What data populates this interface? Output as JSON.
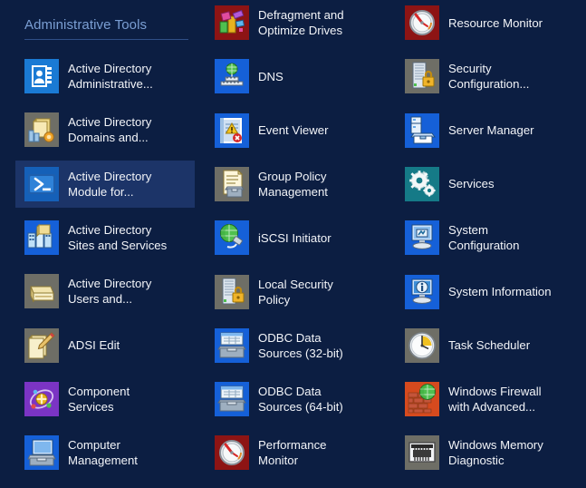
{
  "group": {
    "title": "Administrative Tools",
    "rule_color": "#2f4f86",
    "title_color": "#7b9fd4"
  },
  "theme": {
    "background": "#0c1e42",
    "selection": "#1c3468",
    "label_color": "#f2f4f8"
  },
  "columns": [
    {
      "index": 1,
      "tiles": [
        {
          "label": "Active Directory\nAdministrative...",
          "icon": "address-book-icon",
          "icon_bg": "#1a7ad4",
          "selected": false
        },
        {
          "label": "Active Directory\nDomains and...",
          "icon": "ad-domains-trusts-icon",
          "icon_bg": "#6e6e66",
          "selected": false
        },
        {
          "label": "Active Directory\nModule for...",
          "icon": "powershell-icon",
          "icon_bg": "#1560b8",
          "selected": true
        },
        {
          "label": "Active Directory\nSites and Services",
          "icon": "ad-sites-services-icon",
          "icon_bg": "#1560d8",
          "selected": false
        },
        {
          "label": "Active Directory\nUsers and...",
          "icon": "ad-users-computers-icon",
          "icon_bg": "#6e6e66",
          "selected": false
        },
        {
          "label": "ADSI Edit",
          "icon": "adsi-edit-icon",
          "icon_bg": "#6e6e66",
          "selected": false
        },
        {
          "label": "Component\nServices",
          "icon": "component-services-icon",
          "icon_bg": "#7b34c4",
          "selected": false
        },
        {
          "label": "Computer\nManagement",
          "icon": "computer-management-icon",
          "icon_bg": "#1560d8",
          "selected": false
        }
      ]
    },
    {
      "index": 2,
      "tiles": [
        {
          "label": "Defragment and\nOptimize Drives",
          "icon": "defragment-icon",
          "icon_bg": "#8d1414",
          "selected": false
        },
        {
          "label": "DNS",
          "icon": "dns-icon",
          "icon_bg": "#1560d8",
          "selected": false
        },
        {
          "label": "Event Viewer",
          "icon": "event-viewer-icon",
          "icon_bg": "#1560d8",
          "selected": false
        },
        {
          "label": "Group Policy\nManagement",
          "icon": "group-policy-icon",
          "icon_bg": "#6e6e66",
          "selected": false
        },
        {
          "label": "iSCSI Initiator",
          "icon": "iscsi-initiator-icon",
          "icon_bg": "#1560d8",
          "selected": false
        },
        {
          "label": "Local Security\nPolicy",
          "icon": "local-security-icon",
          "icon_bg": "#6e6e66",
          "selected": false
        },
        {
          "label": "ODBC Data\nSources (32-bit)",
          "icon": "odbc-32-icon",
          "icon_bg": "#1560d8",
          "selected": false
        },
        {
          "label": "ODBC Data\nSources (64-bit)",
          "icon": "odbc-64-icon",
          "icon_bg": "#1560d8",
          "selected": false
        },
        {
          "label": "Performance\nMonitor",
          "icon": "performance-monitor-icon",
          "icon_bg": "#8d1414",
          "selected": false
        }
      ]
    },
    {
      "index": 3,
      "tiles": [
        {
          "label": "Resource Monitor",
          "icon": "resource-monitor-icon",
          "icon_bg": "#8d1414",
          "selected": false
        },
        {
          "label": "Security\nConfiguration...",
          "icon": "security-config-icon",
          "icon_bg": "#6e6e66",
          "selected": false
        },
        {
          "label": "Server Manager",
          "icon": "server-manager-icon",
          "icon_bg": "#1560d8",
          "selected": false
        },
        {
          "label": "Services",
          "icon": "services-gears-icon",
          "icon_bg": "#157a87",
          "selected": false
        },
        {
          "label": "System\nConfiguration",
          "icon": "system-config-icon",
          "icon_bg": "#1560d8",
          "selected": false
        },
        {
          "label": "System Information",
          "icon": "system-information-icon",
          "icon_bg": "#1560d8",
          "selected": false
        },
        {
          "label": "Task Scheduler",
          "icon": "task-scheduler-icon",
          "icon_bg": "#6e6e66",
          "selected": false
        },
        {
          "label": "Windows Firewall\nwith Advanced...",
          "icon": "windows-firewall-icon",
          "icon_bg": "#d64a1e",
          "selected": false
        },
        {
          "label": "Windows Memory\nDiagnostic",
          "icon": "memory-diagnostic-icon",
          "icon_bg": "#6e6e66",
          "selected": false
        }
      ]
    }
  ]
}
